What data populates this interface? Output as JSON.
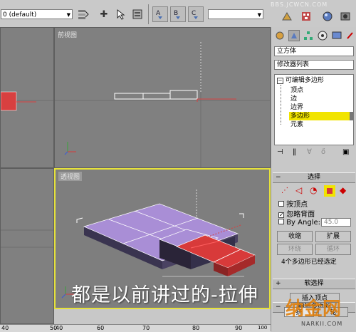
{
  "toolbar": {
    "layer_combo": "0 (default)",
    "selection_combo": "",
    "watermark_top": "BBS.JCWCN.COM"
  },
  "viewports": {
    "front_title": "前视图",
    "persp_title": "透视图"
  },
  "panel": {
    "object_name": "立方体",
    "modifier_list": "修改器列表",
    "stack_root": "可编辑多边形",
    "stack_items": [
      "顶点",
      "边",
      "边界",
      "多边形",
      "元素"
    ],
    "selected_item_index": 3,
    "selection": {
      "title": "选择",
      "by_vertex": "按顶点",
      "ignore_backfacing": "忽略背面",
      "by_angle": "By Angle:",
      "angle_value": "45.0",
      "shrink": "收缩",
      "grow": "扩展",
      "ring": "环绕",
      "loop": "循环",
      "status": "4个多边形已经选定"
    },
    "soft_selection": "软选择",
    "edit_polygons": "编辑多边形",
    "insert_vertex": "插入顶点",
    "bottom_button_1": "挤",
    "bottom_button_2": "轮"
  },
  "caption": "都是以前讲过的-拉伸",
  "ruler_labels": [
    "40",
    "50",
    "60",
    "70",
    "80",
    "90",
    "100"
  ],
  "watermark_logo": "NARKII.COM",
  "colors": {
    "viewport_bg": "#808080",
    "active_border": "#e6e23a",
    "selected_poly": "#d83a3a",
    "box_top": "#a98ed6",
    "highlight": "#f1e400"
  }
}
